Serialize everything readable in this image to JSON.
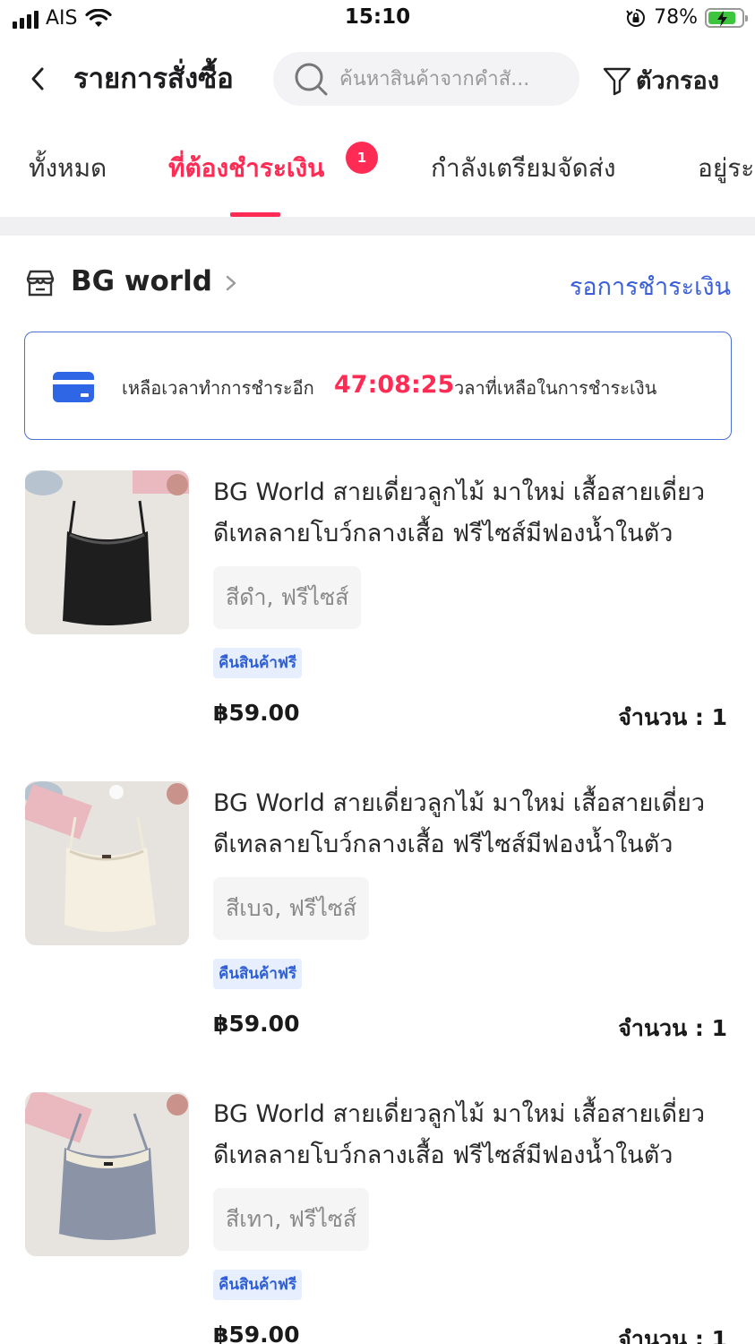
{
  "status_bar": {
    "carrier": "AIS",
    "time": "15:10",
    "battery": "78%"
  },
  "header": {
    "title": "รายการสั่งซื้อ",
    "search_placeholder": "ค้นหาสินค้าจากคำสั่...",
    "filter_label": "ตัวกรอง"
  },
  "tabs": [
    {
      "label": "ทั้งหมด"
    },
    {
      "label": "ที่ต้องชำระเงิน",
      "badge": "1"
    },
    {
      "label": "กำลังเตรียมจัดส่ง"
    },
    {
      "label": "อยู่ระ"
    }
  ],
  "order": {
    "shop_name": "BG world",
    "status": "รอการชำระเงิน",
    "countdown": {
      "label": "เหลือเวลาทำการชำระอีก",
      "timer": "47:08:25",
      "tail": "วลาที่เหลือในการชำระเงิน"
    },
    "items": [
      {
        "title": "BG World สายเดี่ยวลูกไม้ มาใหม่ เสื้อสายเดี่ยว ดีเทลลายโบว์กลางเสื้อ ฟรีไซส์มีฟองน้ำในตัว",
        "variant": "สีดำ, ฟรีไซส์",
        "badge": "คืนสินค้าฟรี",
        "price": "฿59.00",
        "qty": "จำนวน : 1",
        "color": "#1e1e1e"
      },
      {
        "title": "BG World สายเดี่ยวลูกไม้ มาใหม่ เสื้อสายเดี่ยว ดีเทลลายโบว์กลางเสื้อ ฟรีไซส์มีฟองน้ำในตัว",
        "variant": "สีเบจ, ฟรีไซส์",
        "badge": "คืนสินค้าฟรี",
        "price": "฿59.00",
        "qty": "จำนวน : 1",
        "color": "#f4efe1"
      },
      {
        "title": "BG World สายเดี่ยวลูกไม้ มาใหม่ เสื้อสายเดี่ยว ดีเทลลายโบว์กลางเสื้อ ฟรีไซส์มีฟองน้ำในตัว",
        "variant": "สีเทา, ฟรีไซส์",
        "badge": "คืนสินค้าฟรี",
        "price": "฿59.00",
        "qty": "จำนวน : 1",
        "color": "#8a94a6"
      }
    ]
  }
}
